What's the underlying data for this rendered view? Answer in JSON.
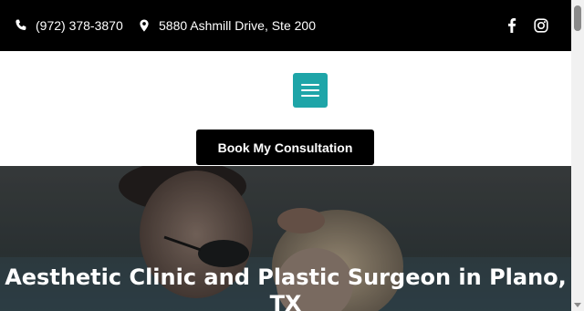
{
  "topbar": {
    "phone": "(972) 378-3870",
    "address": "5880 Ashmill Drive, Ste 200",
    "icons": [
      "phone-icon",
      "map-marker-icon",
      "facebook-icon",
      "instagram-icon"
    ]
  },
  "header": {
    "menu_icon": "hamburger-icon",
    "book_label": "Book My Consultation"
  },
  "hero": {
    "title": "Aesthetic Clinic and Plastic Surgeon in Plano, TX"
  },
  "colors": {
    "topbar_bg": "#000000",
    "menu_button": "#1ea5a8",
    "book_button": "#000000",
    "hero_text": "#ffffff"
  }
}
